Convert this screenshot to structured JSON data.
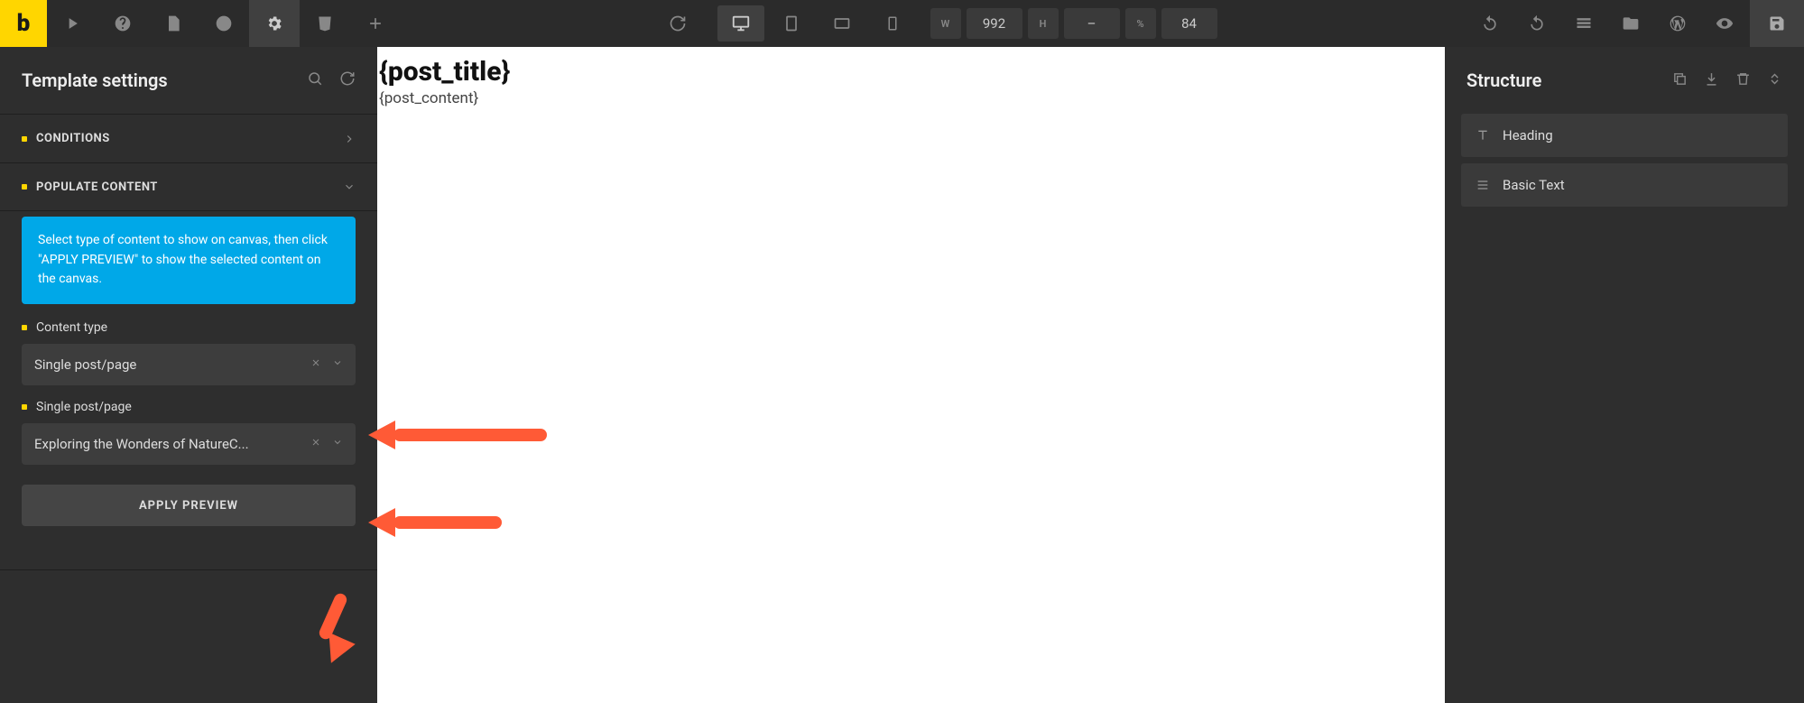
{
  "topbar": {
    "w_label": "W",
    "w_value": "992",
    "h_label": "H",
    "h_value": "–",
    "pct_label": "%",
    "pct_value": "84"
  },
  "left_panel": {
    "title": "Template settings",
    "sections": {
      "conditions": {
        "label": "CONDITIONS"
      },
      "populate": {
        "label": "POPULATE CONTENT",
        "info": "Select type of content to show on canvas, then click \"APPLY PREVIEW\" to show the selected content on the canvas.",
        "content_type_label": "Content type",
        "content_type_value": "Single post/page",
        "single_label": "Single post/page",
        "single_value": "Exploring the Wonders of NatureC...",
        "apply_button": "APPLY PREVIEW"
      }
    }
  },
  "canvas": {
    "title": "{post_title}",
    "content": "{post_content}"
  },
  "right_panel": {
    "title": "Structure",
    "items": [
      {
        "label": "Heading"
      },
      {
        "label": "Basic Text"
      }
    ]
  }
}
